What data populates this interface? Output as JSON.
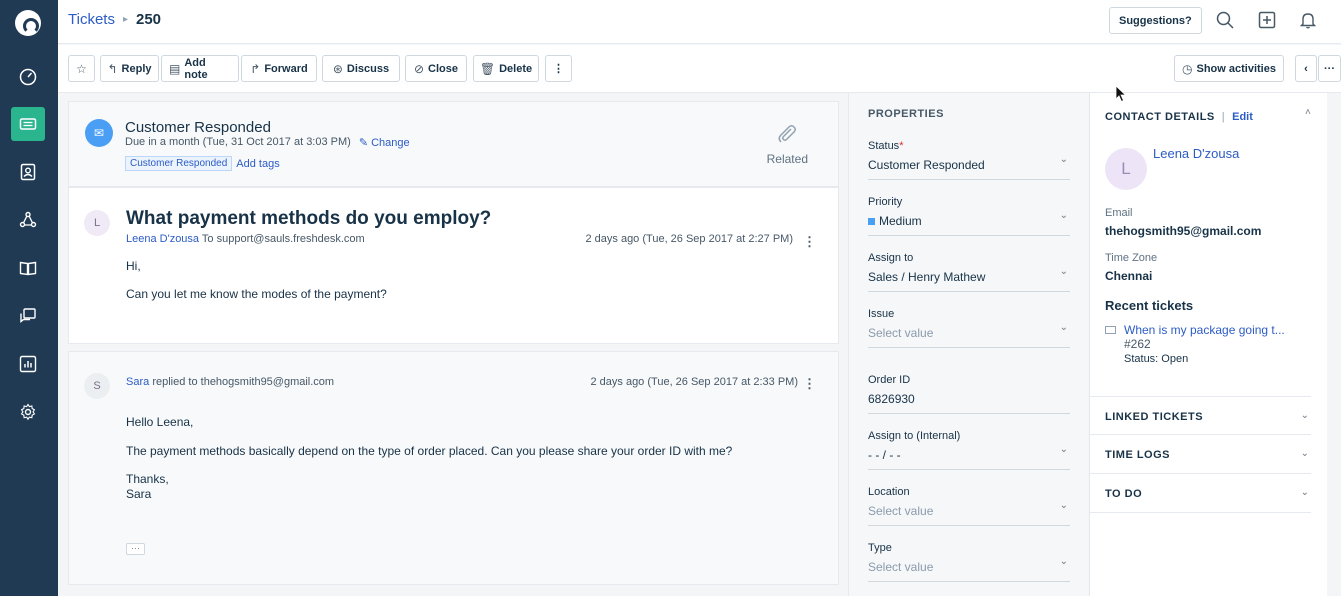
{
  "nav": {
    "items": [
      {
        "name": "dashboard-icon"
      },
      {
        "name": "tickets-icon",
        "active": true
      },
      {
        "name": "contacts-icon"
      },
      {
        "name": "social-icon"
      },
      {
        "name": "solutions-icon"
      },
      {
        "name": "forums-icon"
      },
      {
        "name": "reports-icon"
      },
      {
        "name": "admin-gear-icon"
      }
    ]
  },
  "header": {
    "breadcrumb_link": "Tickets",
    "breadcrumb_sep": "▸",
    "ticket_number": "250",
    "suggestions_label": "Suggestions?"
  },
  "toolbar": {
    "reply": "Reply",
    "add_note": "Add note",
    "forward": "Forward",
    "discuss": "Discuss",
    "close": "Close",
    "delete": "Delete",
    "more": "⋮",
    "show_activities": "Show activities",
    "prev": "‹",
    "overflow": "···"
  },
  "status_card": {
    "title": "Customer Responded",
    "due": "Due in a month (Tue, 31 Oct 2017 at 3:03 PM)",
    "change": "Change",
    "tag": "Customer Responded",
    "add_tags": "Add tags",
    "related": "Related"
  },
  "question": {
    "avatar": "L",
    "title": "What payment methods do you employ?",
    "author": "Leena D'zousa",
    "to_label": "To",
    "to_email": "support@sauls.freshdesk.com",
    "time": "2 days ago (Tue, 26 Sep 2017 at 2:27 PM)",
    "line1": "Hi,",
    "line2": "Can you let me know the modes of the payment?"
  },
  "reply": {
    "avatar": "S",
    "author": "Sara",
    "replied_to": "replied to",
    "to_email": "thehogsmith95@gmail.com",
    "time": "2 days ago (Tue, 26 Sep 2017 at 2:33 PM)",
    "line1": "Hello Leena,",
    "line2": "The payment methods basically depend on the type of order placed. Can you please share your order ID with me?",
    "line3": "Thanks,",
    "line4": "Sara",
    "ellipsis": "···"
  },
  "properties": {
    "title": "PROPERTIES",
    "status_label": "Status",
    "status_req": "*",
    "status_value": "Customer Responded",
    "priority_label": "Priority",
    "priority_value": "Medium",
    "priority_color": "#4a9ff5",
    "assign_label": "Assign to",
    "assign_value": "Sales / Henry Mathew",
    "issue_label": "Issue",
    "issue_value": "Select value",
    "order_label": "Order ID",
    "order_value": "6826930",
    "assign_internal_label": "Assign to (Internal)",
    "assign_internal_value": "- - / - -",
    "location_label": "Location",
    "location_value": "Select value",
    "type_label": "Type",
    "type_value": "Select value"
  },
  "contact": {
    "title": "CONTACT DETAILS",
    "sep": "|",
    "edit": "Edit",
    "avatar": "L",
    "name": "Leena D'zousa",
    "email_label": "Email",
    "email": "thehogsmith95@gmail.com",
    "tz_label": "Time Zone",
    "tz": "Chennai",
    "recent_title": "Recent tickets",
    "recent_link": "When is my package going t...",
    "recent_num": "#262",
    "recent_status": "Status: Open",
    "linked": "LINKED TICKETS",
    "time_logs": "TIME LOGS",
    "todo": "TO DO"
  }
}
